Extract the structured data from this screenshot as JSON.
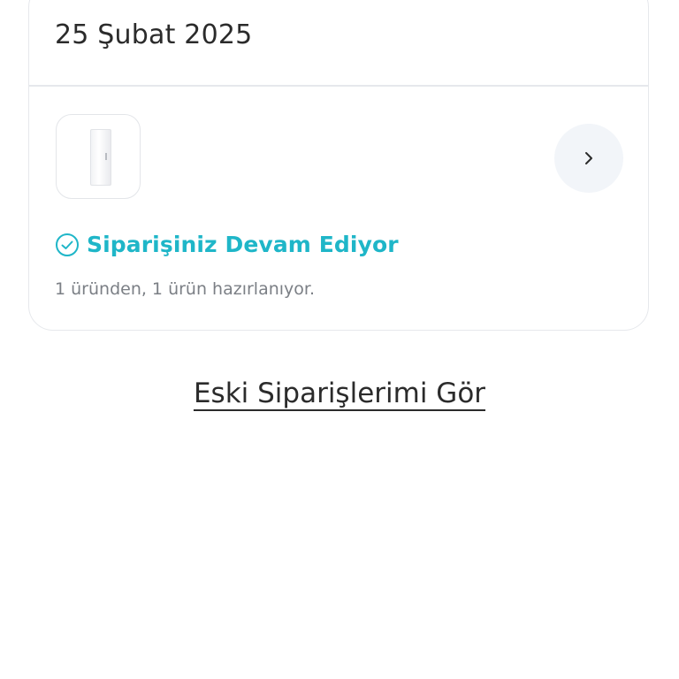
{
  "order": {
    "date": "25 Şubat 2025",
    "status_label": "Siparişiniz Devam Ediyor",
    "summary_text": "1 üründen, 1 ürün hazırlanıyor.",
    "product_icon": "refrigerator-icon",
    "detail_icon": "chevron-right-icon",
    "status_icon": "check-circle-icon"
  },
  "footer": {
    "old_orders_link": "Eski Siparişlerimi Gör"
  },
  "colors": {
    "accent": "#1fb6c8",
    "text_primary": "#2b2b2b",
    "text_secondary": "#7b7f85",
    "border": "#e6e8ec",
    "button_bg": "#f2f5f9"
  }
}
